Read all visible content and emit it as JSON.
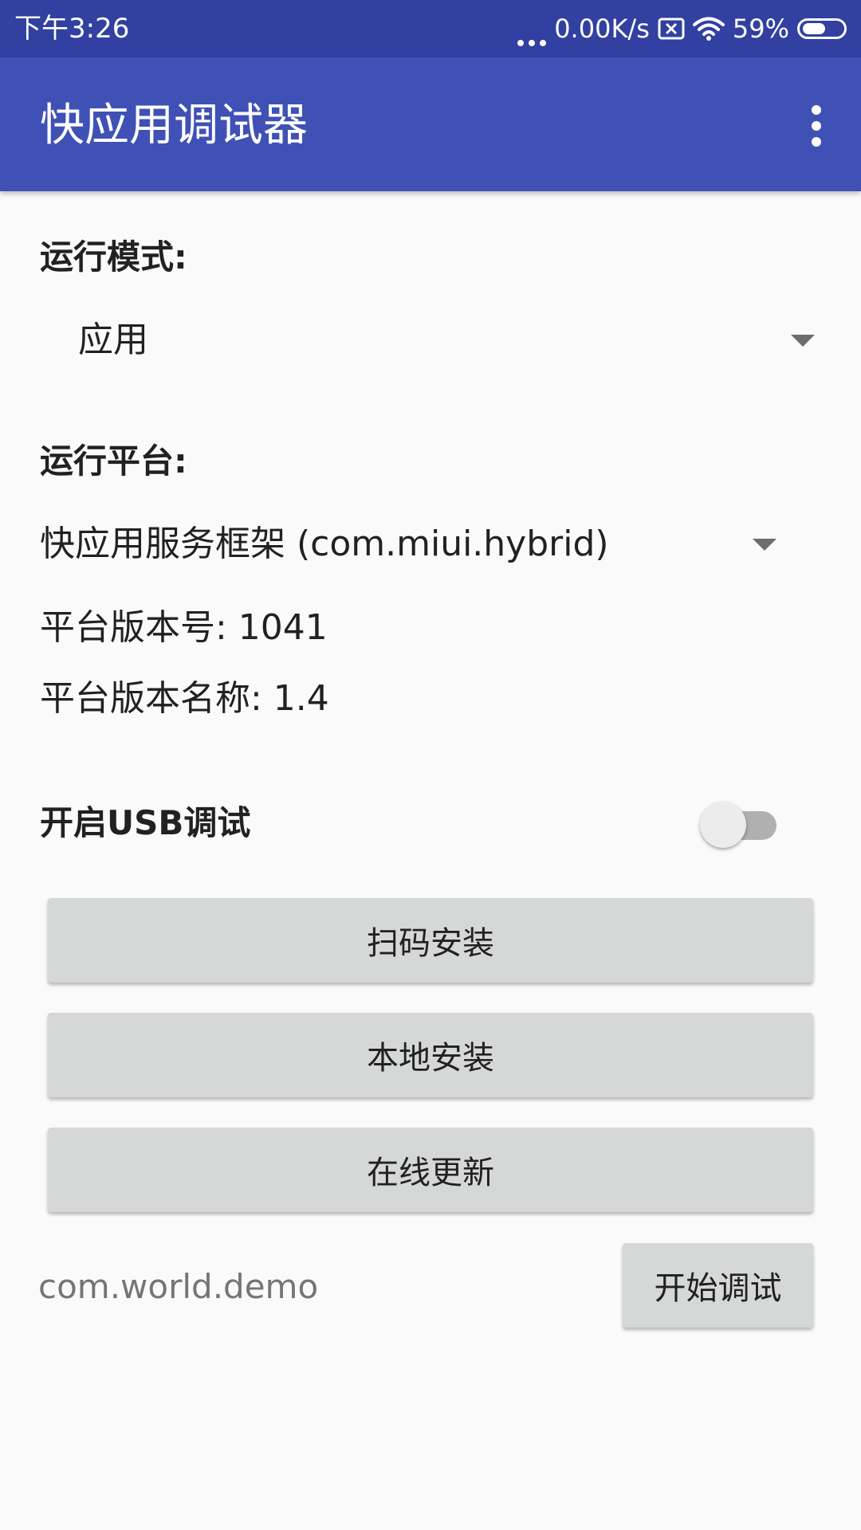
{
  "status_bar": {
    "time": "下午3:26",
    "network_speed": "0.00K/s",
    "battery_percent": "59%",
    "battery_level": 0.59,
    "icons": [
      "more-dots-icon",
      "sim-x-icon",
      "wifi-icon",
      "battery-icon"
    ]
  },
  "app_bar": {
    "title": "快应用调试器",
    "menu_icon": "overflow-menu-icon"
  },
  "run_mode": {
    "label": "运行模式:",
    "selected": "应用"
  },
  "run_platform": {
    "label": "运行平台:",
    "selected": "快应用服务框架 (com.miui.hybrid)",
    "version_code": "平台版本号: 1041",
    "version_name": "平台版本名称: 1.4"
  },
  "usb_debug": {
    "label": "开启USB调试",
    "enabled": false
  },
  "buttons": {
    "scan_install": "扫码安装",
    "local_install": "本地安装",
    "online_update": "在线更新",
    "start_debug": "开始调试"
  },
  "package_field": {
    "value": "com.world.demo"
  },
  "colors": {
    "status_bar": "#3140a1",
    "app_bar": "#3f51b5",
    "background": "#fafafa",
    "button": "#d6d7d7"
  }
}
